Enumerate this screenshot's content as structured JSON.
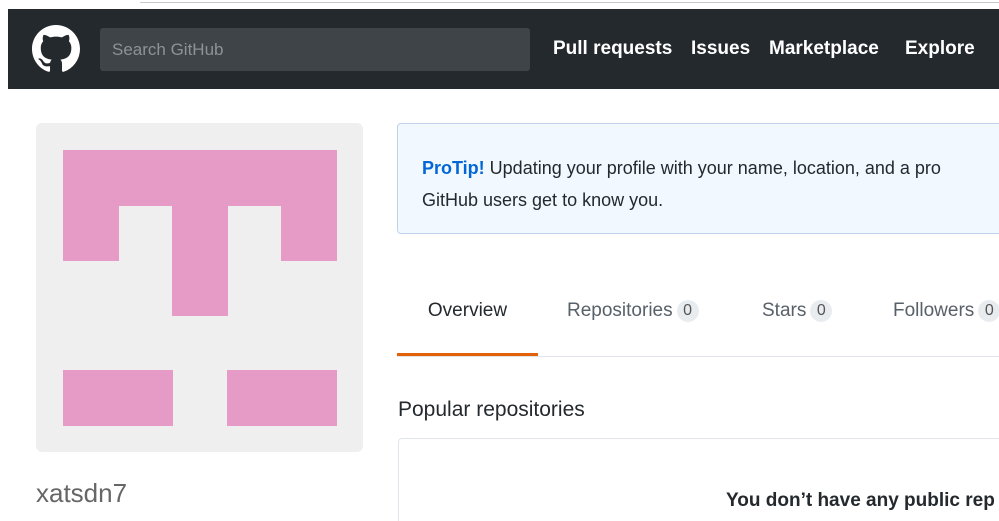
{
  "header": {
    "search_placeholder": "Search GitHub",
    "nav": {
      "pull_requests": "Pull requests",
      "issues": "Issues",
      "marketplace": "Marketplace",
      "explore": "Explore"
    },
    "logo_icon": "github-octocat-icon"
  },
  "colors": {
    "header_bg": "#24292e",
    "avatar_bg": "#efefef",
    "avatar_pink": "#e69bc7",
    "protip_bg": "#f1f8ff",
    "protip_label": "#0366d6",
    "tab_active": "#e36209"
  },
  "profile": {
    "username": "xatsdn7"
  },
  "protip": {
    "label": "ProTip!",
    "line1": " Updating your profile with your name, location, and a pro",
    "line2": "GitHub users get to know you."
  },
  "tabs": {
    "overview": "Overview",
    "repositories": "Repositories",
    "repositories_count": "0",
    "stars": "Stars",
    "stars_count": "0",
    "followers": "Followers",
    "followers_count": "0"
  },
  "popular": {
    "title": "Popular repositories",
    "empty_message": "You don’t have any public rep"
  }
}
